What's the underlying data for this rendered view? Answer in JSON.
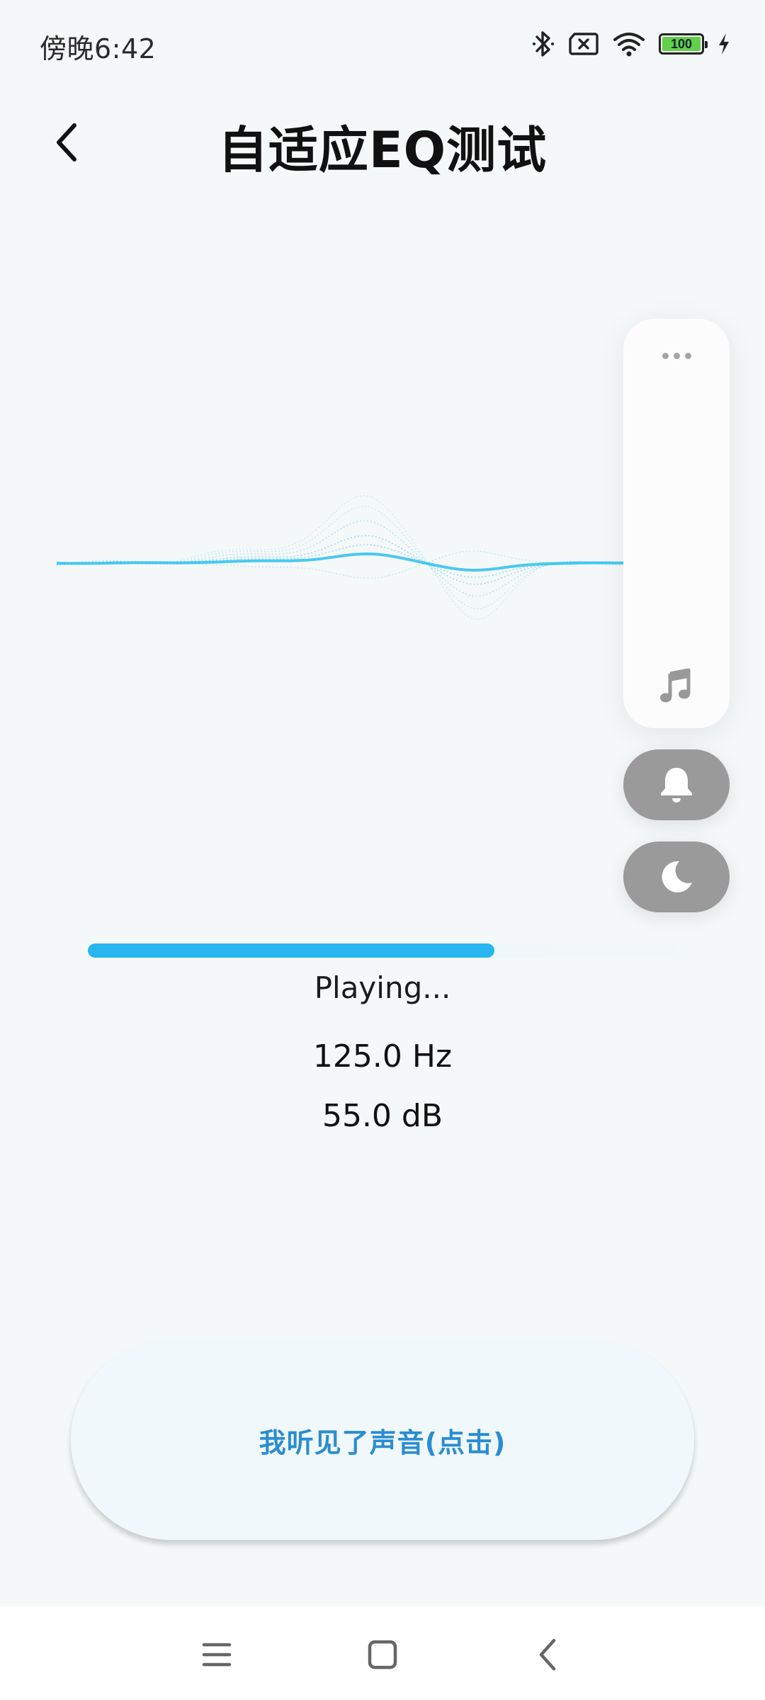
{
  "status_bar": {
    "time": "傍晚6:42",
    "battery_level": "100",
    "icons": [
      "bluetooth-icon",
      "no-sim-icon",
      "wifi-icon",
      "battery-icon",
      "charging-icon"
    ]
  },
  "header": {
    "title": "自适应EQ测试",
    "back_icon": "chevron-left-icon"
  },
  "side_panel": {
    "more_icon": "more-dots-icon",
    "music_icon": "music-note-icon",
    "bell_icon": "bell-icon",
    "moon_icon": "moon-icon"
  },
  "test": {
    "progress": 0.69,
    "status": "Playing...",
    "frequency": "125.0 Hz",
    "level": "55.0 dB"
  },
  "confirm": {
    "label": "我听见了声音(点击)"
  },
  "nav_bar": {
    "icons": [
      "menu-icon",
      "home-icon",
      "back-icon"
    ]
  },
  "colors": {
    "accent": "#27b6ef",
    "wave": "#37c3ee",
    "confirm_text": "#2a8dd1",
    "pill": "#9a9a9a",
    "background": "#f5f8f8"
  }
}
